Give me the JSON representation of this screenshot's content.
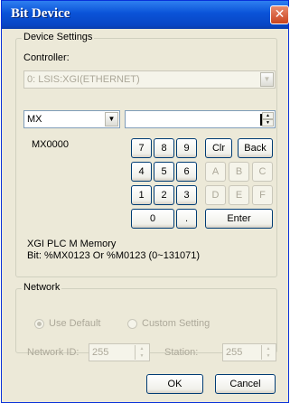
{
  "window": {
    "title": "Bit Device",
    "close_symbol": "✕"
  },
  "device_settings": {
    "legend": "Device Settings",
    "controller_label": "Controller:",
    "controller_value": "0: LSIS:XGI(ETHERNET)",
    "device_type": "MX",
    "address_value": "",
    "device_preview": "MX0000"
  },
  "keypad": {
    "row1": [
      "7",
      "8",
      "9",
      "Clr",
      "Back"
    ],
    "row2": [
      "4",
      "5",
      "6",
      "A",
      "B",
      "C"
    ],
    "row3": [
      "1",
      "2",
      "3",
      "D",
      "E",
      "F"
    ],
    "row4": [
      "0",
      ".",
      "Enter"
    ]
  },
  "hint": {
    "line1": "XGI PLC M Memory",
    "line2": "Bit: %MX0123 Or %M0123 (0~131071)"
  },
  "network": {
    "legend": "Network",
    "use_default": "Use Default",
    "custom_setting": "Custom Setting",
    "network_id_label": "Network ID:",
    "network_id_value": "255",
    "station_label": "Station:",
    "station_value": "255"
  },
  "buttons": {
    "ok": "OK",
    "cancel": "Cancel"
  }
}
